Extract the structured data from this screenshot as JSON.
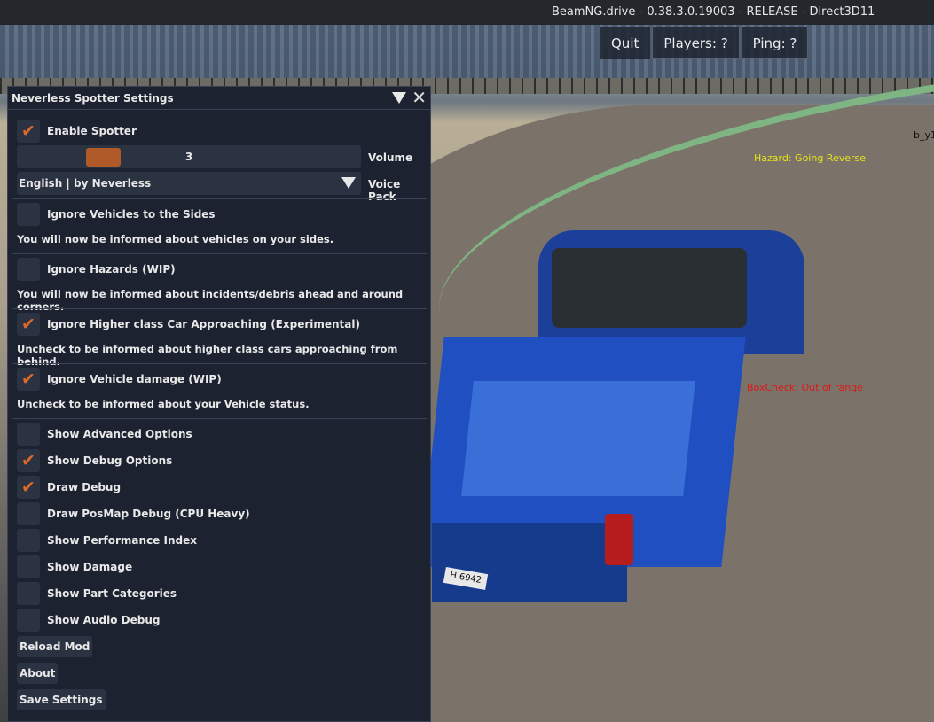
{
  "window": {
    "title": "BeamNG.drive - 0.38.3.0.19003 - RELEASE - Direct3D11"
  },
  "topbar": {
    "quit": "Quit",
    "players": "Players: ?",
    "ping": "Ping: ?"
  },
  "overlays": {
    "hazard": "Hazard: Going Reverse",
    "boxcheck": "BoxCheck: Out of range",
    "label_b": "b_y1",
    "plate": "H 6942"
  },
  "panel": {
    "title": "Neverless Spotter Settings",
    "enable_spotter": {
      "label": "Enable Spotter",
      "checked": true
    },
    "volume": {
      "label": "Volume",
      "value": "3"
    },
    "voice_pack": {
      "label": "Voice Pack",
      "selected": "English | by Neverless"
    },
    "sections": [
      {
        "label": "Ignore Vehicles to the Sides",
        "checked": false,
        "desc": "You will now be informed about vehicles on your sides."
      },
      {
        "label": "Ignore Hazards (WIP)",
        "checked": false,
        "desc": "You will now be informed about incidents/debris ahead and around corners."
      },
      {
        "label": "Ignore Higher class Car Approaching (Experimental)",
        "checked": true,
        "desc": "Uncheck to be informed about higher class cars approaching from behind."
      },
      {
        "label": "Ignore Vehicle damage (WIP)",
        "checked": true,
        "desc": "Uncheck to be informed about your Vehicle status."
      }
    ],
    "options": [
      {
        "label": "Show Advanced Options",
        "checked": false
      },
      {
        "label": "Show Debug Options",
        "checked": true
      },
      {
        "label": "Draw Debug",
        "checked": true
      },
      {
        "label": "Draw PosMap Debug (CPU Heavy)",
        "checked": false
      },
      {
        "label": "Show Performance Index",
        "checked": false
      },
      {
        "label": "Show Damage",
        "checked": false
      },
      {
        "label": "Show Part Categories",
        "checked": false
      },
      {
        "label": "Show Audio Debug",
        "checked": false
      }
    ],
    "buttons": {
      "reload": "Reload Mod",
      "about": "About",
      "save": "Save Settings"
    }
  },
  "colors": {
    "accent": "#e0692a",
    "panel": "#1c2230"
  }
}
